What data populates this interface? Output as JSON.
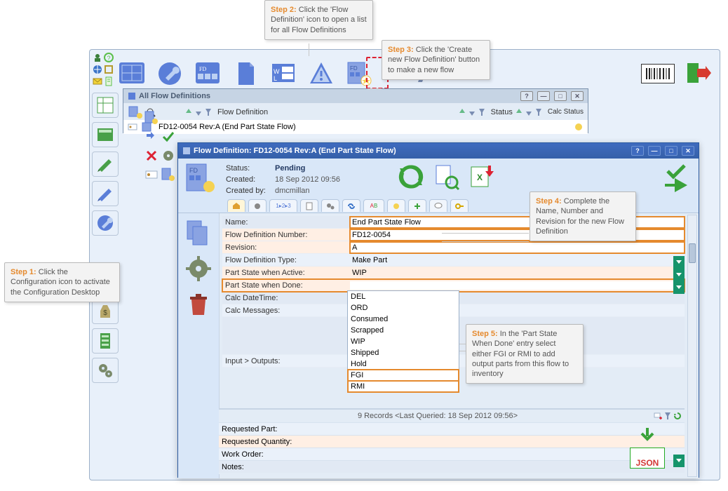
{
  "toolbar": {
    "icons": [
      "blueprint",
      "wrench-circle",
      "fd-grid",
      "page",
      "wl-box",
      "warning-triangle",
      "new-flow-def",
      "gun-scan"
    ]
  },
  "left_strip_mini": [
    "person-help",
    "globe",
    "mail",
    "doc"
  ],
  "sidebar": {
    "items": [
      {
        "icon": "green-grid",
        "name": "sidebar-item-1"
      },
      {
        "icon": "window-green",
        "name": "sidebar-item-2"
      },
      {
        "icon": "pencil-green",
        "name": "sidebar-item-3"
      },
      {
        "icon": "pencil-blue",
        "name": "sidebar-item-4"
      },
      {
        "icon": "wrench-blue",
        "name": "sidebar-item-5"
      },
      {
        "icon": "blueprint-small",
        "name": "sidebar-item-6"
      },
      {
        "icon": "factory",
        "name": "sidebar-item-7"
      },
      {
        "icon": "money-bag",
        "name": "sidebar-item-8"
      },
      {
        "icon": "cabinet",
        "name": "sidebar-item-9"
      },
      {
        "icon": "gears",
        "name": "sidebar-item-10"
      }
    ]
  },
  "list_window": {
    "title": "All Flow Definitions",
    "cols": {
      "c1": "Flow Definition",
      "c2": "Status",
      "c3": "Calc Status"
    },
    "row": {
      "text": "FD12-0054 Rev:A (End Part State Flow)"
    }
  },
  "detail_window": {
    "title": "Flow Definition: FD12-0054 Rev:A (End Part State Flow)",
    "meta": {
      "status_label": "Status:",
      "status_value": "Pending",
      "created_label": "Created:",
      "created_value": "18 Sep 2012 09:56",
      "createdby_label": "Created by:",
      "createdby_value": "dmcmillan"
    },
    "form": {
      "name_label": "Name:",
      "name_value": "End Part State Flow",
      "number_label": "Flow Definition Number:",
      "number_value": "FD12-0054",
      "revision_label": "Revision:",
      "revision_value": "A",
      "type_label": "Flow Definition Type:",
      "type_value": "Make Part",
      "active_label": "Part State when Active:",
      "active_value": "WIP",
      "done_label": "Part State when Done:",
      "done_value": "",
      "calcdt_label": "Calc DateTime:",
      "calcdt_value": "",
      "calcmsg_label": "Calc Messages:",
      "calcmsg_value": "",
      "io_label": "Input > Outputs:",
      "io_value": ""
    },
    "dropdown": {
      "options": [
        "DEL",
        "ORD",
        "Consumed",
        "Scrapped",
        "WIP",
        "Shipped",
        "Hold",
        "FGI",
        "RMI"
      ]
    },
    "subgrid": {
      "summary": "9 Records <Last Queried: 18 Sep 2012 09:56>",
      "req_part_label": "Requested Part:",
      "req_qty_label": "Requested Quantity:",
      "wo_label": "Work Order:",
      "notes_label": "Notes:"
    }
  },
  "steps": {
    "s1_bold": "Step 1:",
    "s1_text": " Click the Configuration icon to activate the Configuration Desktop",
    "s2_bold": "Step 2:",
    "s2_text": " Click the 'Flow Definition' icon to open a list for all Flow Definitions",
    "s3_bold": "Step 3:",
    "s3_text": " Click the 'Create new Flow Definition' button to make a new flow",
    "s4_bold": "Step 4:",
    "s4_text": " Complete the Name, Number and Revision for the new Flow Definition",
    "s5_bold": "Step 5:",
    "s5_text": " In the 'Part State When Done' entry select either FGI or RMI to add output parts from this flow to inventory"
  },
  "json_badge": "JSON"
}
